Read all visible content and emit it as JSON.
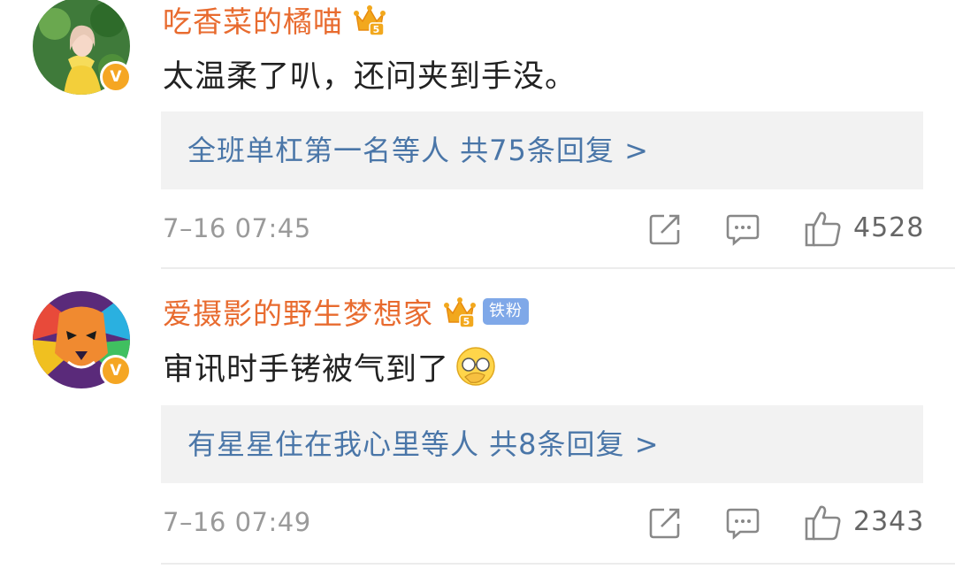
{
  "comments": [
    {
      "username": "吃香菜的橘喵",
      "verified_badge": "V",
      "crown_level": "5",
      "text": "太温柔了叭，还问夹到手没。",
      "replies_link": "全班单杠第一名等人  共75条回复 >",
      "timestamp": "7–16 07:45",
      "likes": "4528"
    },
    {
      "username": "爱摄影的野生梦想家",
      "verified_badge": "V",
      "crown_level": "5",
      "fan_badge": "铁粉",
      "text": "审讯时手铐被气到了",
      "replies_link": "有星星住在我心里等人  共8条回复 >",
      "timestamp": "7–16 07:49",
      "likes": "2343"
    }
  ],
  "colors": {
    "username": "#e86b2f",
    "link": "#4a76a8",
    "meta": "#9a9a9a",
    "reply_bg": "#f2f2f2",
    "verified": "#f5a623"
  }
}
